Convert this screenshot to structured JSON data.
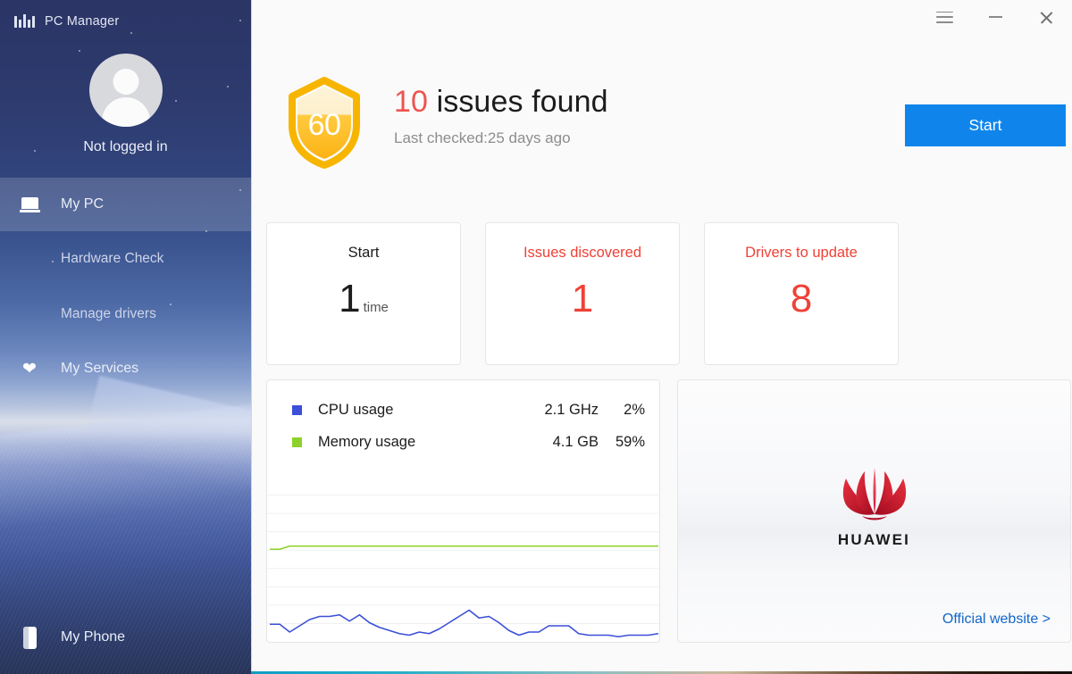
{
  "sidebar": {
    "brand": {
      "logo_icon": "pcmanager-logo-icon",
      "title": "PC Manager"
    },
    "profile": {
      "avatar_icon": "avatar-placeholder-icon",
      "status": "Not logged in"
    },
    "items": [
      {
        "label": "My PC",
        "icon": "laptop-icon",
        "active": true
      },
      {
        "label": "Hardware Check",
        "icon": "",
        "active": false
      },
      {
        "label": "Manage drivers",
        "icon": "",
        "active": false
      },
      {
        "label": "My Services",
        "icon": "heart-icon",
        "active": false
      }
    ],
    "bottom_item": {
      "label": "My Phone",
      "icon": "phone-icon"
    }
  },
  "titlebar": {
    "menu_icon": "hamburger-menu-icon",
    "minimize_icon": "minimize-icon",
    "close_icon": "close-icon"
  },
  "hero": {
    "shield_icon": "shield-score-icon",
    "score": "60",
    "issue_count": "10",
    "title_rest": " issues found",
    "last_checked": "Last checked:25 days ago",
    "start_button": "Start"
  },
  "cards": [
    {
      "label": "Start",
      "value": "1",
      "unit": "time",
      "accent": "dark"
    },
    {
      "label": "Issues discovered",
      "value": "1",
      "unit": "",
      "accent": "red"
    },
    {
      "label": "Drivers to update",
      "value": "8",
      "unit": "",
      "accent": "red"
    }
  ],
  "usage": {
    "rows": [
      {
        "name": "CPU usage",
        "primary": "2.1 GHz",
        "percent": "2%",
        "color": "#3b4fd8"
      },
      {
        "name": "Memory usage",
        "primary": "4.1 GB",
        "percent": "59%",
        "color": "#8dd22b"
      }
    ]
  },
  "promo": {
    "logo_icon": "huawei-logo-icon",
    "brand": "HUAWEI",
    "link": "Official website >"
  },
  "colors": {
    "accent_blue": "#0f85ec",
    "alert_red": "#ef4136",
    "cpu_blue": "#3b4fd8",
    "memory_green": "#8dd22b",
    "shield_gold": "#f7b500",
    "huawei_red": "#cf0a2c",
    "sidebar_dark": "#2b3566"
  },
  "chart_data": {
    "type": "line",
    "title": "",
    "xlabel": "",
    "ylabel": "",
    "ylim": [
      0,
      100
    ],
    "grid": true,
    "gridlines": 8,
    "legend_position": "top",
    "series": [
      {
        "name": "CPU usage",
        "color": "#3b4fd8",
        "unit": "%",
        "current": 2,
        "values": [
          9,
          9,
          4,
          8,
          12,
          14,
          14,
          15,
          11,
          15,
          10,
          7,
          5,
          3,
          2,
          4,
          3,
          6,
          10,
          14,
          18,
          13,
          14,
          10,
          5,
          2,
          4,
          4,
          8,
          8,
          8,
          3,
          2,
          2,
          2,
          1,
          2,
          2,
          2,
          3
        ]
      },
      {
        "name": "Memory usage",
        "color": "#8dd22b",
        "unit": "%",
        "current": 59,
        "values": [
          57,
          57,
          59,
          59,
          59,
          59,
          59,
          59,
          59,
          59,
          59,
          59,
          59,
          59,
          59,
          59,
          59,
          59,
          59,
          59,
          59,
          59,
          59,
          59,
          59,
          59,
          59,
          59,
          59,
          59,
          59,
          59,
          59,
          59,
          59,
          59,
          59,
          59,
          59,
          59
        ]
      }
    ]
  }
}
